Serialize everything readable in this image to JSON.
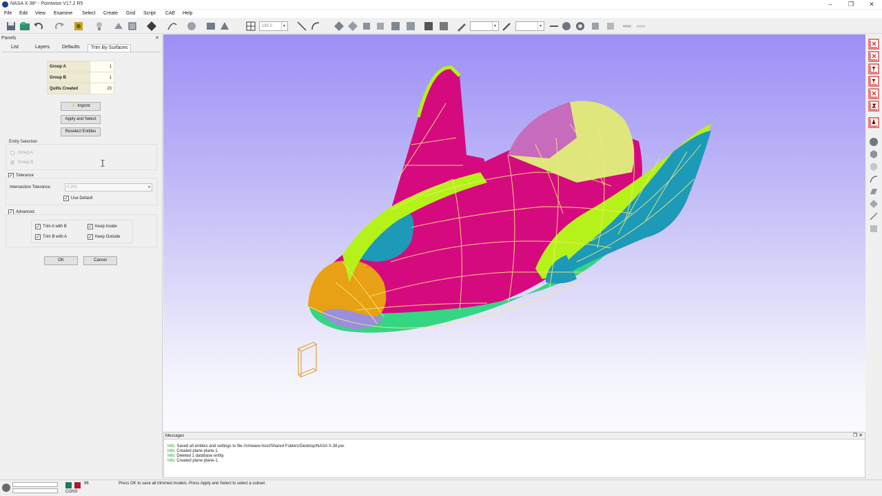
{
  "window": {
    "title": "NASA X-38* - Pointwise V17.2 R5",
    "buttons": [
      "–",
      "❐",
      "✕"
    ]
  },
  "menu": [
    "File",
    "Edit",
    "View",
    "Examine",
    "Select",
    "Create",
    "Grid",
    "Script",
    "CAE",
    "Help"
  ],
  "toolbar": {
    "combo1": "180.0",
    "combo2": "",
    "combo3": ""
  },
  "panels": {
    "title": "Panels",
    "close": "✕",
    "tabs": [
      "List",
      "Layers",
      "Defaults",
      "Trim By Surfaces"
    ],
    "active_tab": 3,
    "group_table": [
      {
        "label": "Group A",
        "value": "1"
      },
      {
        "label": "Group B",
        "value": "1"
      },
      {
        "label": "Quilts Created",
        "value": "23"
      }
    ],
    "buttons": {
      "imprint": "Imprint",
      "apply_select": "Apply and Select",
      "reselect": "Reselect Entities",
      "ok": "OK",
      "cancel": "Cancel"
    },
    "entity_selection": {
      "title": "Entity Selection",
      "options": [
        "Group A",
        "Group B"
      ]
    },
    "tolerance": {
      "label": "Tolerance",
      "checked": true,
      "intersection_label": "Intersection Tolerance:",
      "intersection_value": "0.001",
      "use_default": "Use Default",
      "use_default_checked": true
    },
    "advanced": {
      "label": "Advanced",
      "checked": true,
      "options": [
        {
          "label": "Trim A with B",
          "checked": true
        },
        {
          "label": "Keep Inside",
          "checked": true
        },
        {
          "label": "Trim B with A",
          "checked": true
        },
        {
          "label": "Keep Outside",
          "checked": true
        }
      ]
    }
  },
  "messages": {
    "title": "Messages",
    "lines": [
      {
        "tag": "Info:",
        "text": "Saved all entities and settings to file //vmware-host/Shared Folders/Desktop/NASA X-38.pw."
      },
      {
        "tag": "Info:",
        "text": "Created plane plane-1."
      },
      {
        "tag": "Info:",
        "text": "Deleted 1 database entity."
      },
      {
        "tag": "Info:",
        "text": "Created plane plane-1."
      }
    ]
  },
  "status": {
    "message": "Press OK to save all trimmed models. Press Apply and Select to select a subset.",
    "units": "CGNS",
    "counter": "96"
  },
  "colors": {
    "magenta": "#d60a7f",
    "lime": "#b5f21a",
    "teal": "#1c9ab7",
    "yellow": "#dfe67c",
    "orange": "#e8a014",
    "green": "#35d683",
    "wire": "#f3e97a",
    "viewport_top": "#9b8ff6"
  }
}
